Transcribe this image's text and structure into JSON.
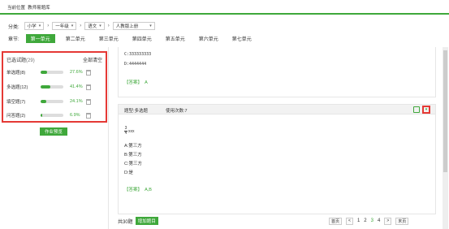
{
  "breadcrumb": {
    "label": "当前位置",
    "current": "教师易题库"
  },
  "filters": {
    "label": "分类:",
    "stage": "小学",
    "grade": "一年级",
    "subject": "语文",
    "edition": "人教版上册"
  },
  "chapter": {
    "label": "章节:",
    "units": [
      "第一单元",
      "第二单元",
      "第三单元",
      "第四单元",
      "第五单元",
      "第六单元",
      "第七单元"
    ],
    "active_index": 0
  },
  "selected_panel": {
    "title": "已选试题",
    "count": "(29)",
    "clear_all": "全部清空",
    "rows": [
      {
        "name": "单选题",
        "count": "(8)",
        "percent": "27.6%",
        "fill": 0.276
      },
      {
        "name": "多选题",
        "count": "(12)",
        "percent": "41.4%",
        "fill": 0.414
      },
      {
        "name": "填空题",
        "count": "(7)",
        "percent": "24.1%",
        "fill": 0.241
      },
      {
        "name": "问答题",
        "count": "(2)",
        "percent": "6.9%",
        "fill": 0.069
      }
    ],
    "preview_button": "作业预览"
  },
  "question1": {
    "option_c": "C:333333333",
    "option_d": "D:4444444",
    "answer_label": "【答案】",
    "answer_value": "A"
  },
  "question2": {
    "type_label": "题型:多选题",
    "usage_label": "使用次数:",
    "usage_value": "7",
    "frac_num": "3",
    "frac_den": "4",
    "stem_suffix": "xxx",
    "options": [
      "A:第三方",
      "B:第三方",
      "C:第三方",
      "D:是"
    ],
    "answer_label": "【答案】",
    "answer_value": "A,B"
  },
  "footer": {
    "total": "共30题",
    "add_button": "增加题目",
    "first": "首页",
    "prev": "<",
    "pages": [
      "1",
      "2",
      "3",
      "4"
    ],
    "current_page": "3",
    "next": ">",
    "last": "末页"
  },
  "colors": {
    "accent": "#3fa83b",
    "highlight": "#e53935"
  },
  "icons": {
    "edit": "edit-icon",
    "download": "download-icon",
    "trash": "trash-icon",
    "dropdown": "chevron-down-icon"
  }
}
